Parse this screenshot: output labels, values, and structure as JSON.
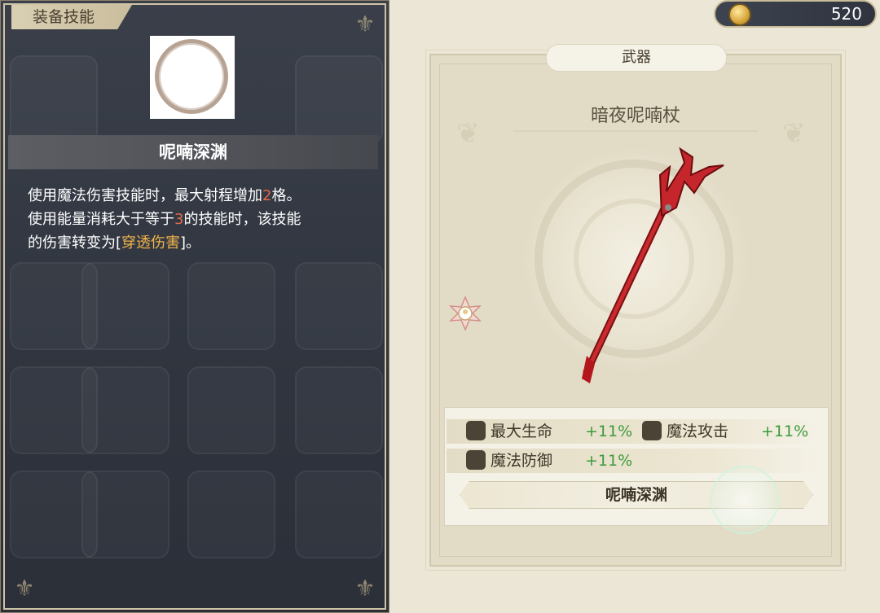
{
  "currency": {
    "icon": "coin-icon",
    "amount": "520"
  },
  "skill_panel": {
    "tab_label": "装备技能",
    "skill_name": "呢喃深渊",
    "description": {
      "line1_prefix": "使用魔法伤害技能时，最大射程增加",
      "line1_num": "2",
      "line1_suffix": "格。",
      "line2_prefix": "使用能量消耗大于等于",
      "line2_num": "3",
      "line2_suffix": "的技能时，该技能",
      "line3_prefix": "的伤害转变为[",
      "line3_highlight": "穿透伤害",
      "line3_suffix": "]。"
    }
  },
  "equipment": {
    "category": "武器",
    "name": "暗夜呢喃杖",
    "stats": [
      {
        "icon": "heart-icon",
        "label": "最大生命",
        "value": "+11%"
      },
      {
        "icon": "wand-icon",
        "label": "魔法攻击",
        "value": "+11%"
      },
      {
        "icon": "hat-icon",
        "label": "魔法防御",
        "value": "+11%"
      }
    ],
    "skill_button": "呢喃深渊"
  },
  "colors": {
    "stat_positive": "#3c9a3a",
    "highlight_red": "#e36a4a",
    "highlight_orange": "#f0b44a"
  }
}
